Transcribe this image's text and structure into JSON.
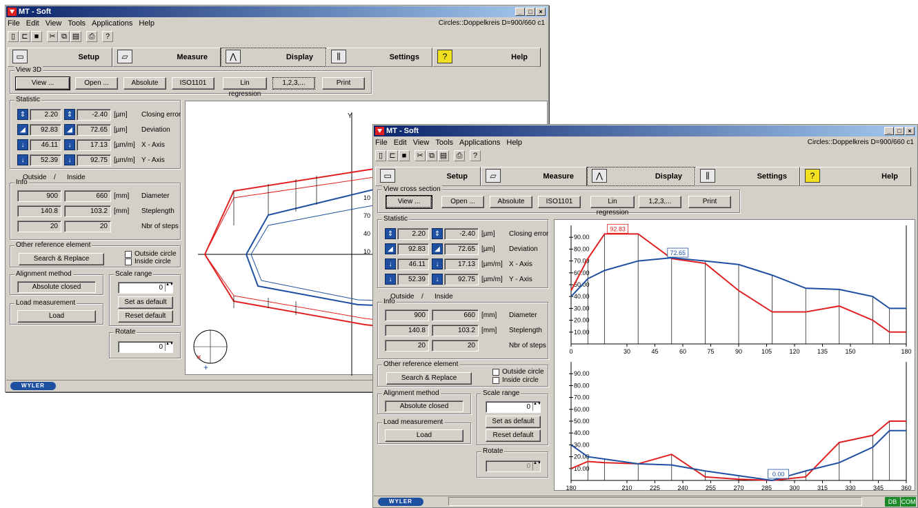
{
  "app": {
    "title": "MT - Soft",
    "menu": [
      "File",
      "Edit",
      "View",
      "Tools",
      "Applications",
      "Help"
    ],
    "context": "Circles::Doppelkreis D=900/660 c1",
    "toolbar_icons": [
      "new-icon",
      "open-icon",
      "save-icon",
      "cut-icon",
      "copy-icon",
      "paste-icon",
      "print-icon",
      "help-icon"
    ],
    "window_buttons": [
      "_",
      "□",
      "×"
    ]
  },
  "tabs": [
    {
      "label": "Setup",
      "icon": "computer-icon"
    },
    {
      "label": "Measure",
      "icon": "measure-icon"
    },
    {
      "label": "Display",
      "icon": "display-icon"
    },
    {
      "label": "Settings",
      "icon": "settings-icon"
    },
    {
      "label": "Help",
      "icon": "question-icon"
    }
  ],
  "back": {
    "view_group": "View 3D",
    "buttons": [
      "View ...",
      "Open ...",
      "Absolute",
      "ISO1101",
      "Lin regression",
      "1,2,3,...",
      "Print"
    ]
  },
  "front": {
    "view_group": "View cross section",
    "buttons": [
      "View ...",
      "Open ...",
      "Absolute",
      "ISO1101",
      "Lin regression",
      "1,2,3,...",
      "Print"
    ]
  },
  "statistic": {
    "label": "Statistic",
    "rows": [
      {
        "a": "2.20",
        "b": "-2.40",
        "unit": "[µm]",
        "name": "Closing error"
      },
      {
        "a": "92.83",
        "b": "72.65",
        "unit": "[µm]",
        "name": "Deviation"
      },
      {
        "a": "46.11",
        "b": "17.13",
        "unit": "[µm/m]",
        "name": "X - Axis"
      },
      {
        "a": "52.39",
        "b": "92.75",
        "unit": "[µm/m]",
        "name": "Y - Axis"
      }
    ]
  },
  "info": {
    "label": "Info",
    "outside": "Outside",
    "sep": "/",
    "inside": "Inside",
    "rows": [
      {
        "a": "900",
        "b": "660",
        "unit": "[mm]",
        "name": "Diameter"
      },
      {
        "a": "140.8",
        "b": "103.2",
        "unit": "[mm]",
        "name": "Steplength"
      },
      {
        "a": "20",
        "b": "20",
        "unit": "",
        "name": "Nbr of steps"
      }
    ]
  },
  "other_ref": {
    "label": "Other reference element",
    "button": "Search & Replace",
    "outside": "Outside circle",
    "inside": "Inside circle"
  },
  "alignment": {
    "label": "Alignment method",
    "value": "Absolute closed"
  },
  "scale": {
    "label": "Scale range",
    "value": "0",
    "set_default": "Set as default",
    "reset_default": "Reset default"
  },
  "load": {
    "label": "Load measurement",
    "button": "Load"
  },
  "rotate": {
    "label": "Rotate",
    "value": "0"
  },
  "plot3d": {
    "y_label": "Y",
    "ticks": [
      "10",
      "70",
      "40",
      "10"
    ]
  },
  "status": {
    "brand": "WYLER",
    "db": "DB",
    "com": "COM"
  },
  "chart_data": [
    {
      "type": "line",
      "x": [
        0,
        9,
        18,
        36,
        54,
        72,
        90,
        108,
        126,
        144,
        162,
        171,
        180
      ],
      "xticks": [
        0,
        30,
        45,
        60,
        75,
        90,
        105,
        120,
        135,
        150,
        165,
        180
      ],
      "xtick_labels": [
        "0",
        "30",
        "45",
        "60",
        "75",
        "90",
        "105",
        "120",
        "135",
        "150",
        "180"
      ],
      "ylim": [
        0,
        100
      ],
      "yticks": [
        10,
        20,
        30,
        40,
        50,
        60,
        70,
        80,
        90
      ],
      "ytick_labels": [
        "10.00",
        "20.00",
        "30.00",
        "40.00",
        "50.00",
        "60.00",
        "70.00",
        "80.00",
        "90.00"
      ],
      "series": [
        {
          "color": "#e02020",
          "values": [
            45,
            72,
            92.83,
            92.83,
            72,
            68,
            45,
            27,
            27,
            32,
            20,
            10,
            10
          ]
        },
        {
          "color": "#1e4fa0",
          "values": [
            40,
            55,
            62,
            70,
            72.65,
            70,
            67,
            58,
            47,
            46,
            40,
            30,
            30
          ]
        }
      ],
      "annotations": [
        {
          "text": "92.83",
          "color": "#e02020"
        },
        {
          "text": "72.65",
          "color": "#1e4fa0"
        }
      ]
    },
    {
      "type": "line",
      "xticks": [
        180,
        195,
        210,
        225,
        240,
        255,
        270,
        285,
        300,
        315,
        330,
        345,
        360
      ],
      "xtick_labels": [
        "180",
        "210",
        "225",
        "240",
        "255",
        "270",
        "285",
        "300",
        "315",
        "330",
        "345",
        "360"
      ],
      "ylim": [
        0,
        100
      ],
      "yticks": [
        10,
        20,
        30,
        40,
        50,
        60,
        70,
        80,
        90
      ],
      "ytick_labels": [
        "10.00",
        "20.00",
        "30.00",
        "40.00",
        "50.00",
        "60.00",
        "70.00",
        "80.00",
        "90.00"
      ],
      "x": [
        180,
        189,
        198,
        216,
        234,
        252,
        270,
        288,
        306,
        324,
        342,
        351,
        360
      ],
      "series": [
        {
          "color": "#e02020",
          "values": [
            10,
            16,
            15,
            14,
            22,
            3,
            1,
            0,
            3,
            32,
            38,
            50,
            50
          ]
        },
        {
          "color": "#1e4fa0",
          "values": [
            30,
            20,
            18,
            14,
            13,
            8,
            4,
            0,
            8,
            15,
            28,
            42,
            42
          ]
        }
      ],
      "annotations": [
        {
          "text": "0.00",
          "color": "#1e4fa0"
        }
      ]
    }
  ]
}
